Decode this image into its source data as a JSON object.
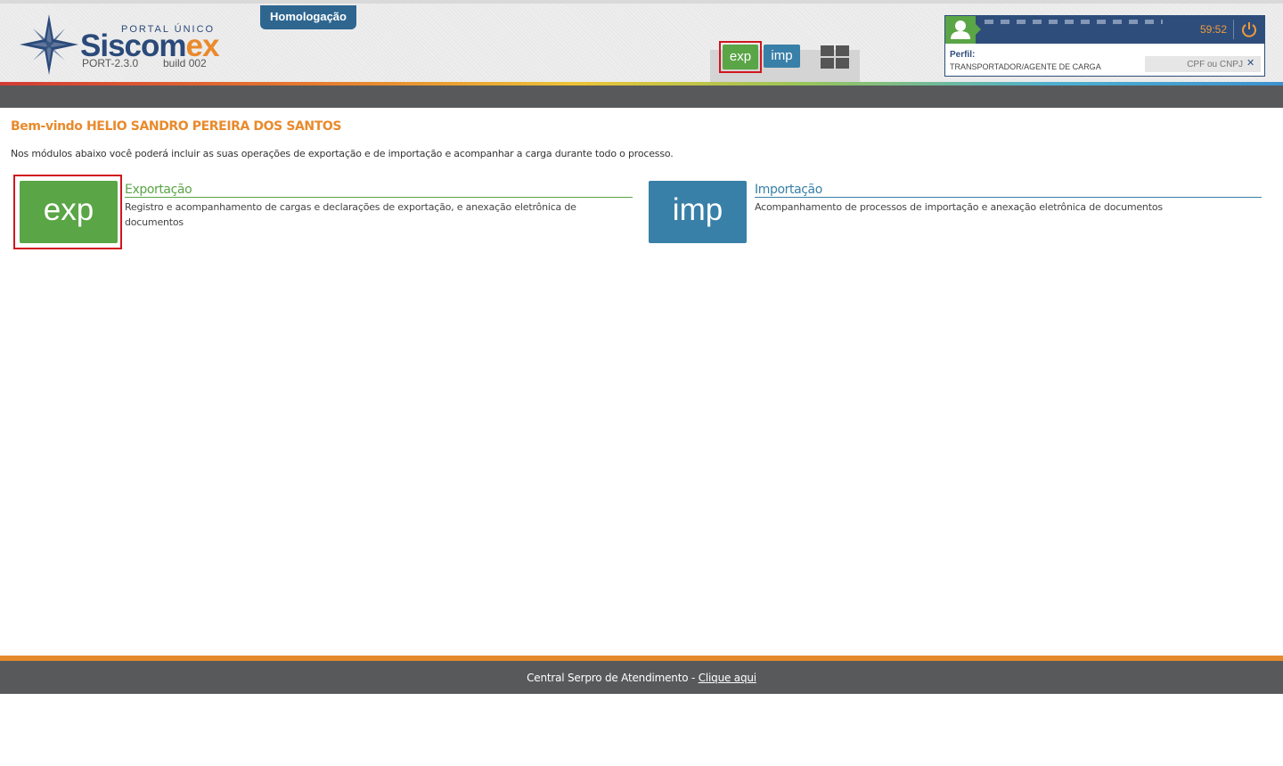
{
  "header": {
    "logo": {
      "portal": "PORTAL ÚNICO",
      "brand_main": "Siscom",
      "brand_accent": "ex",
      "version": "PORT-2.3.0",
      "build": "build 002"
    },
    "environment_badge": "Homologação",
    "quick_modules": {
      "exp_label": "exp",
      "imp_label": "imp",
      "apps_icon": "grid-icon"
    },
    "user": {
      "avatar_icon": "user-icon",
      "session_timer": "59:52",
      "logout_icon": "power-icon",
      "profile_label": "Perfil:",
      "profile_value": "TRANSPORTADOR/AGENTE DE CARGA",
      "cpf_placeholder": "CPF ou CNPJ",
      "clear_icon": "close-icon"
    }
  },
  "main": {
    "welcome": "Bem-vindo HELIO SANDRO PEREIRA DOS SANTOS",
    "intro": "Nos módulos abaixo você poderá incluir as suas operações de exportação e de importação e acompanhar a carga durante todo o processo.",
    "modules": [
      {
        "tile": "exp",
        "title": "Exportação",
        "description": "Registro e acompanhamento de cargas e declarações de exportação, e anexação eletrônica de documentos",
        "color": "#5aa546"
      },
      {
        "tile": "imp",
        "title": "Importação",
        "description": "Acompanhamento de processos de importação e anexação eletrônica de documentos",
        "color": "#3880a8"
      }
    ]
  },
  "footer": {
    "text": "Central Serpro de Atendimento - ",
    "link": "Clique aqui"
  },
  "colors": {
    "brand_blue": "#2b4a7a",
    "accent_orange": "#e98a2c",
    "exp_green": "#5aa546",
    "imp_blue": "#3880a8",
    "highlight_red": "#d0161d",
    "bar_gray": "#58595b"
  }
}
